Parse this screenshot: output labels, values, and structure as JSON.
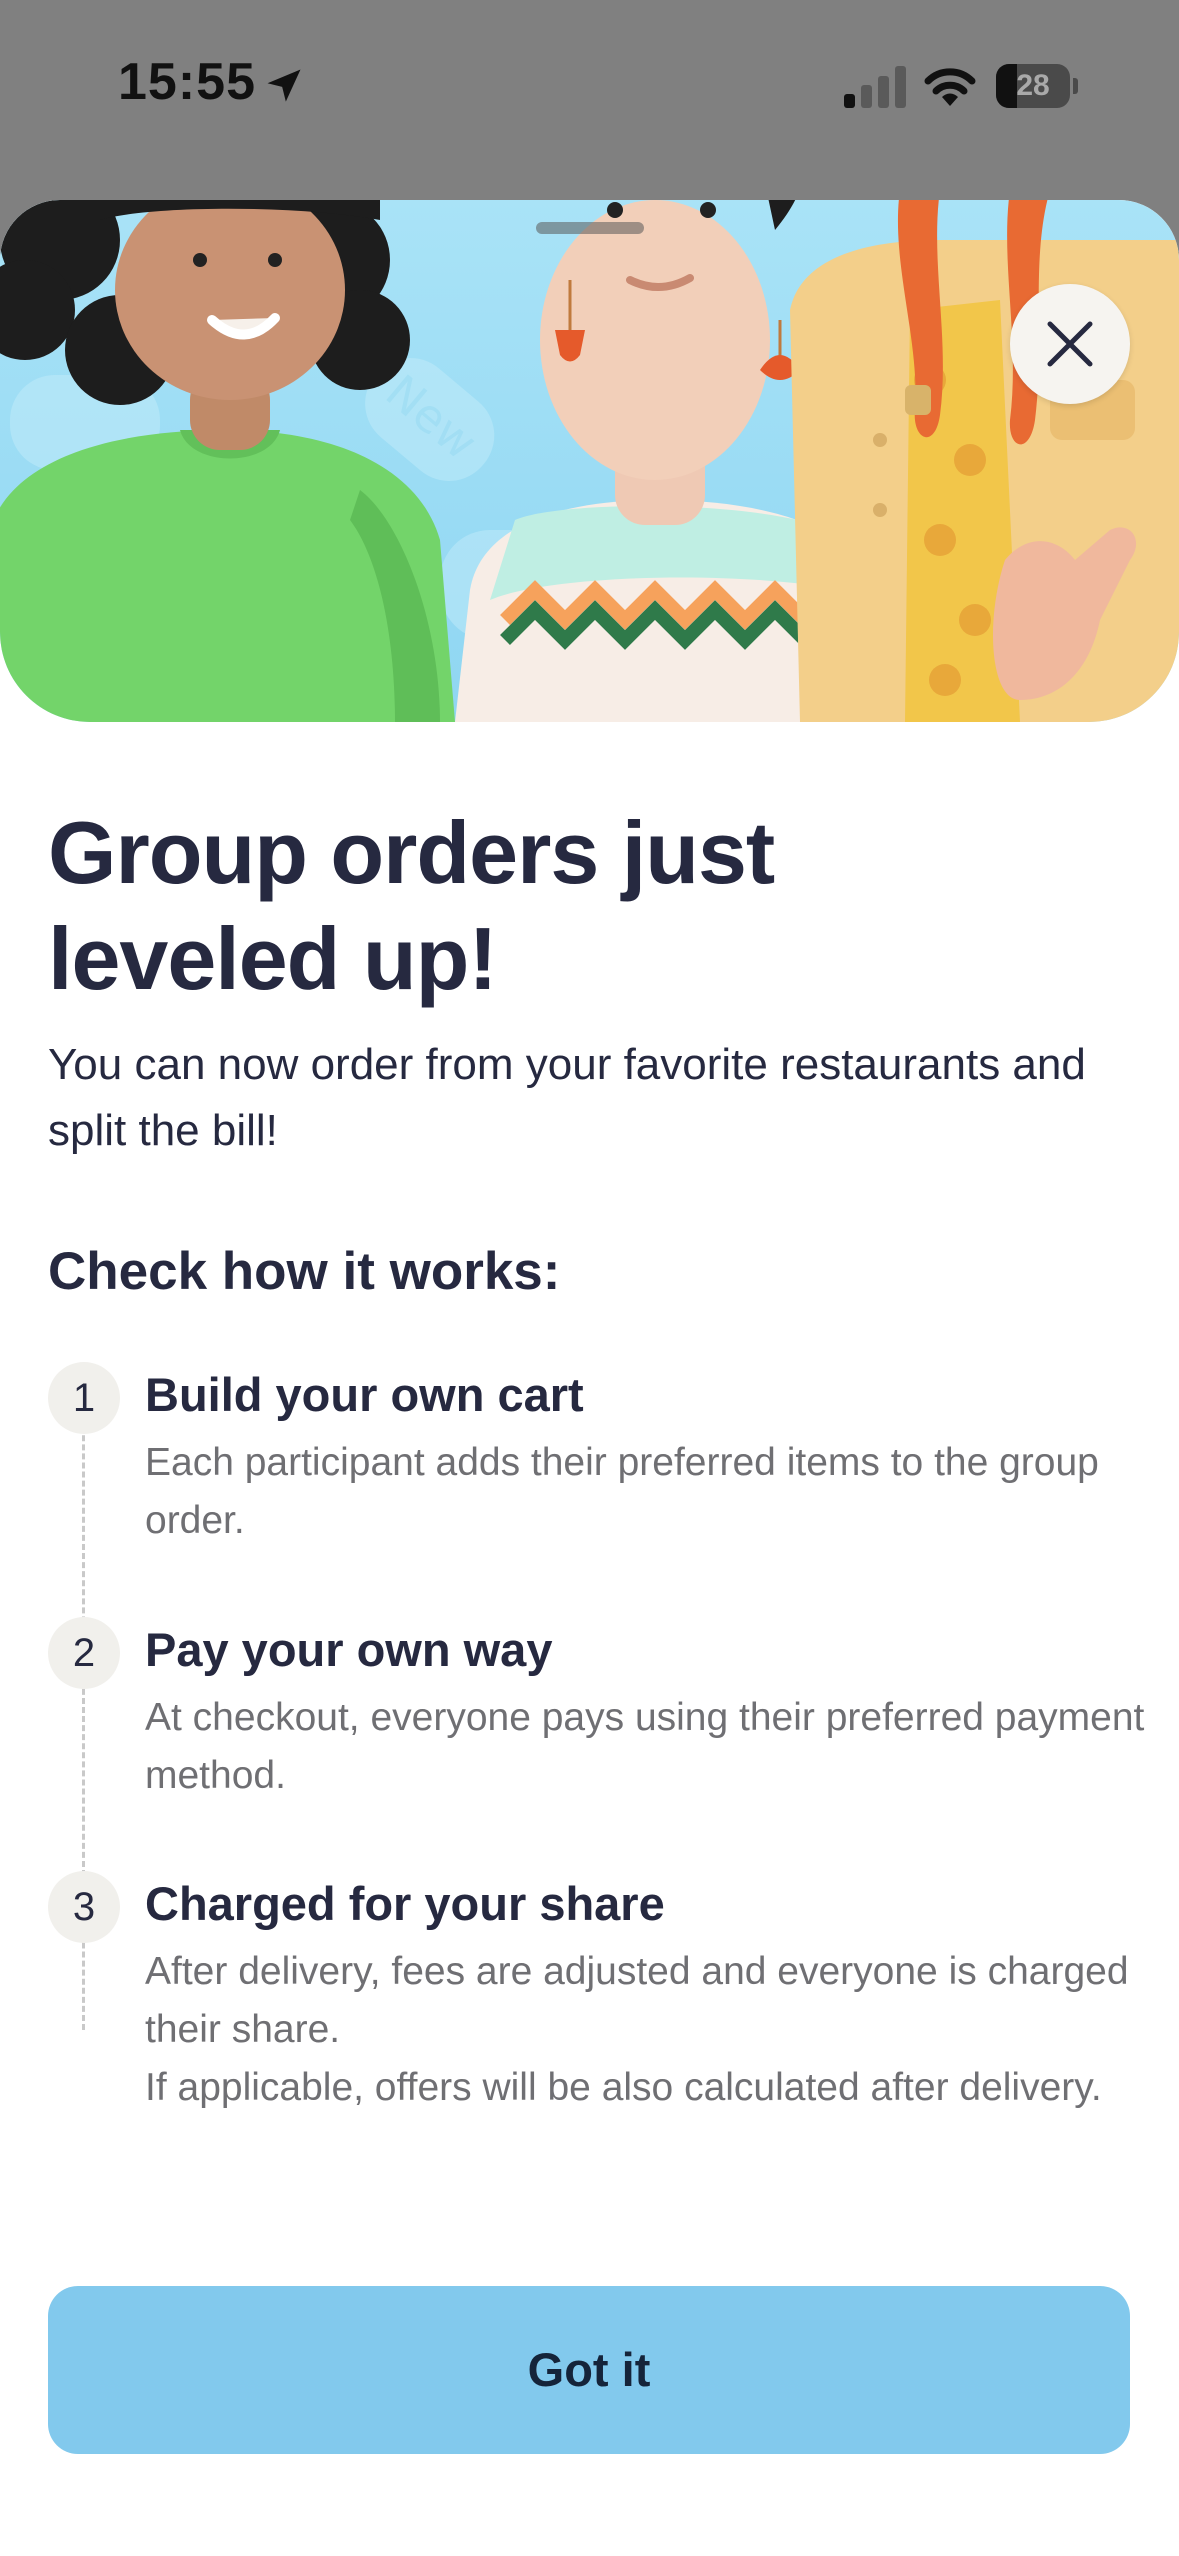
{
  "status_bar": {
    "time": "15:55",
    "battery_level": "28",
    "battery_fraction": 0.28
  },
  "icons": {
    "location": "location-arrow-icon",
    "signal": "cellular-signal-icon",
    "wifi": "wifi-icon",
    "battery": "battery-icon",
    "close": "close-icon"
  },
  "hero": {
    "badge_text": "New",
    "accent_color": "#8fd6f2"
  },
  "content": {
    "title": "Group orders just leveled up!",
    "subtitle": "You can now order from your favorite restaurants and split the bill!",
    "section_heading": "Check how it works:"
  },
  "steps": [
    {
      "number": "1",
      "title": "Build your own cart",
      "description": "Each participant adds their preferred items to the group order."
    },
    {
      "number": "2",
      "title": "Pay your own way",
      "description": "At checkout, everyone pays using their preferred payment method."
    },
    {
      "number": "3",
      "title": "Charged for your share",
      "description": "After delivery, fees are adjusted and everyone is charged their share.",
      "note": "If applicable, offers will be also calculated after delivery."
    }
  ],
  "actions": {
    "primary_label": "Got it",
    "primary_color": "#82c9ed"
  }
}
